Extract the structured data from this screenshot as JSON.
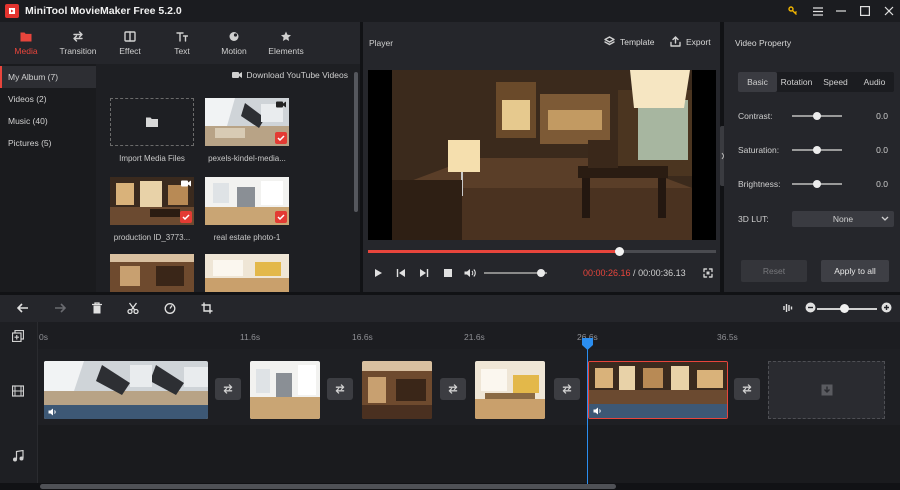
{
  "window": {
    "title": "MiniTool MovieMaker Free 5.2.0"
  },
  "toolbar": {
    "items": [
      {
        "label": "Media",
        "icon": "folder-icon",
        "active": true
      },
      {
        "label": "Transition",
        "icon": "swap-arrows-icon"
      },
      {
        "label": "Effect",
        "icon": "effect-icon"
      },
      {
        "label": "Text",
        "icon": "text-icon"
      },
      {
        "label": "Motion",
        "icon": "motion-icon"
      },
      {
        "label": "Elements",
        "icon": "elements-icon"
      }
    ]
  },
  "media": {
    "albums": [
      {
        "label": "My Album (7)",
        "selected": true
      },
      {
        "label": "Videos (2)"
      },
      {
        "label": "Music (40)"
      },
      {
        "label": "Pictures (5)"
      }
    ],
    "download_label": "Download YouTube Videos",
    "items": [
      {
        "label": "Import Media Files"
      },
      {
        "label": "pexels-kindel-media..."
      },
      {
        "label": "production ID_3773..."
      },
      {
        "label": "real estate photo-1"
      },
      {
        "label": ""
      },
      {
        "label": ""
      }
    ]
  },
  "player": {
    "title": "Player",
    "template_label": "Template",
    "export_label": "Export",
    "progress": 0.72,
    "volume": 0.9,
    "time_current": "00:00:26.16",
    "time_separator": " / ",
    "time_total": "00:00:36.13"
  },
  "props": {
    "title": "Video Property",
    "tabs": [
      "Basic",
      "Rotation",
      "Speed",
      "Audio"
    ],
    "rows": [
      {
        "label": "Contrast:",
        "value": "0.0",
        "level": 0.5
      },
      {
        "label": "Saturation:",
        "value": "0.0",
        "level": 0.5
      },
      {
        "label": "Brightness:",
        "value": "0.0",
        "level": 0.5
      }
    ],
    "lut_label": "3D LUT:",
    "lut_value": "None",
    "reset_label": "Reset",
    "apply_label": "Apply to all"
  },
  "timeline": {
    "ticks": [
      "0s",
      "11.6s",
      "16.6s",
      "21.6s",
      "26.6s",
      "36.5s"
    ],
    "zoom": 0.45
  },
  "colors": {
    "accent": "#e8453c",
    "playhead": "#2b8ef0",
    "audio": "#3d5875"
  }
}
